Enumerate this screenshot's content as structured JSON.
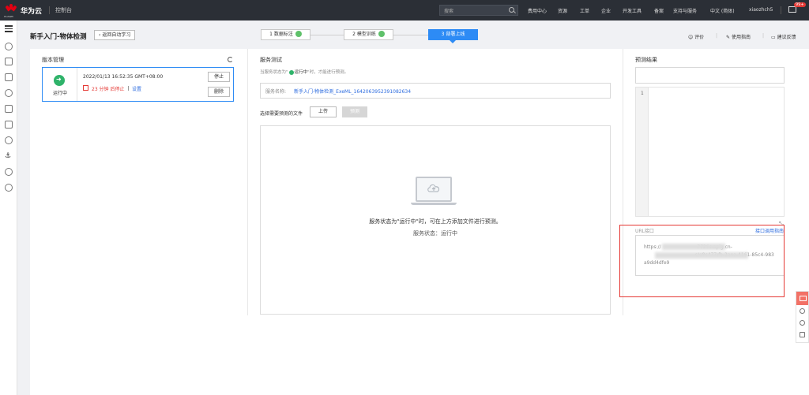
{
  "topbar": {
    "logo_text": "HUAWEI",
    "brand": "华为云",
    "console": "控制台",
    "search_placeholder": "搜索",
    "nav": [
      "费用中心",
      "资源",
      "工单",
      "企业",
      "开发工具",
      "备案",
      "支持与服务",
      "中文 (简体)",
      "xiaozhch5"
    ],
    "mail_badge": "99+"
  },
  "page": {
    "title": "新手入门-物体检测",
    "back": "返回自动学习",
    "steps": [
      {
        "label": "1 数据标注",
        "done": true
      },
      {
        "label": "2 模型训练",
        "done": true
      },
      {
        "label": "3 部署上线",
        "active": true
      }
    ],
    "actions": [
      "评价",
      "使用指南",
      "建议反馈"
    ]
  },
  "version": {
    "title": "版本管理",
    "status": "运行中",
    "time": "2022/01/13 16:52:35 GMT+08:00",
    "countdown": "23 分钟 后停止",
    "setting": "设置",
    "stop": "停止",
    "delete": "删除"
  },
  "service": {
    "title": "服务测试",
    "hint_pre": "当服务状态为\"",
    "hint_status": "运行中",
    "hint_post": "\"时，才能进行预测。",
    "name_label": "服务名称:",
    "name_value": "新手入门-物体检测_ExeML_1642063952391082634",
    "file_label": "选择需要预测的文件",
    "upload": "上传",
    "predict": "预测",
    "drop_msg": "服务状态为\"运行中\"时，可在上方添加文件进行预测。",
    "drop_status": "服务状态：运行中"
  },
  "prediction": {
    "title": "预测结果",
    "line_no": "1",
    "api_label": "URL接口",
    "api_link": "接口调用指南",
    "api_url": "https://                        7736c.apig.cn-                                  s/e8c477db-2aea-4161-85c4-983a9dd4dfe9"
  },
  "colors": {
    "accent": "#2d8bf5",
    "running": "#2fb36a",
    "warning": "#e53935"
  }
}
